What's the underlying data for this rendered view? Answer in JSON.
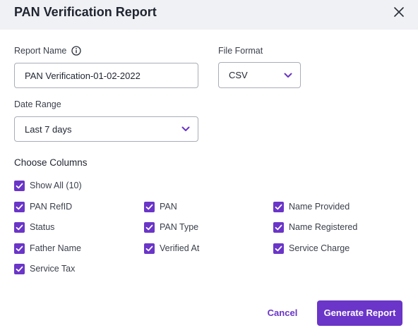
{
  "dialog": {
    "title": "PAN Verification Report"
  },
  "report_name": {
    "label": "Report Name",
    "value": "PAN Verification-01-02-2022"
  },
  "file_format": {
    "label": "File Format",
    "selected": "CSV"
  },
  "date_range": {
    "label": "Date Range",
    "selected": "Last 7 days"
  },
  "columns": {
    "title": "Choose Columns",
    "show_all": "Show All (10)",
    "items": [
      "PAN RefID",
      "PAN",
      "Name Provided",
      "Status",
      "PAN Type",
      "Name Registered",
      "Father Name",
      "Verified At",
      "Service Charge",
      "Service Tax"
    ]
  },
  "actions": {
    "cancel": "Cancel",
    "generate": "Generate Report"
  },
  "colors": {
    "accent": "#6a35c8",
    "header_bg": "#f0f1f4"
  },
  "icons": {
    "close": "close-icon",
    "info": "info-icon",
    "chevron": "chevron-down-icon",
    "check": "check-icon"
  }
}
